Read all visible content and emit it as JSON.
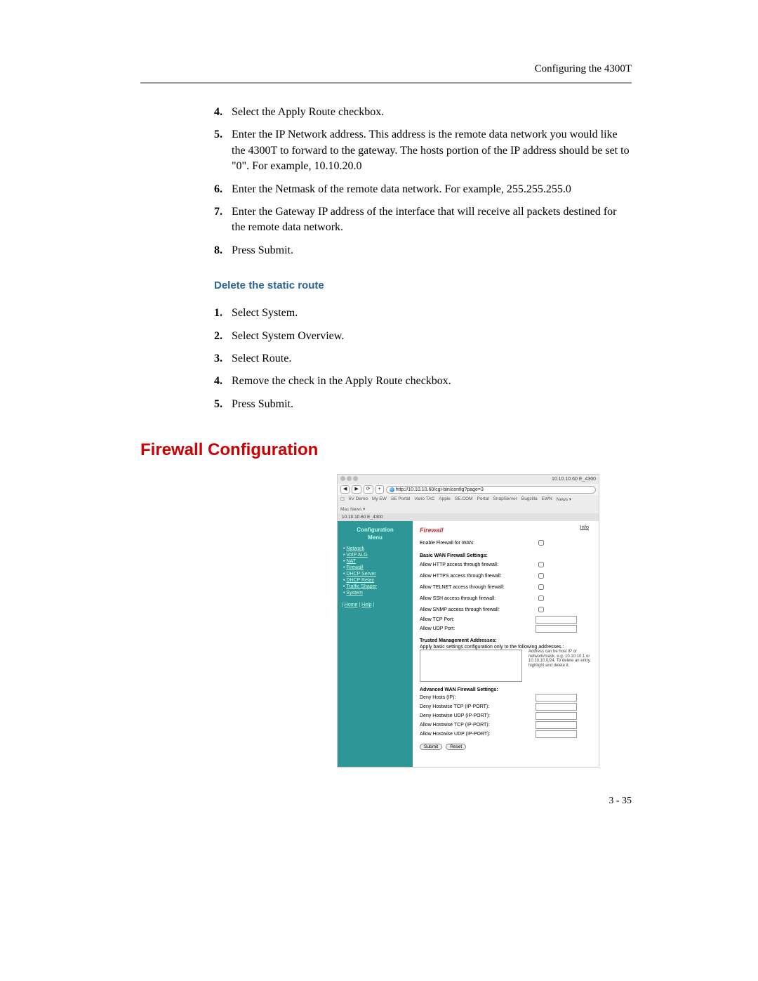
{
  "header": {
    "title": "Configuring the 4300T"
  },
  "steps1": [
    {
      "n": "4.",
      "t": "Select the Apply Route checkbox."
    },
    {
      "n": "5.",
      "t": "Enter the IP Network address.  This address is the remote data network you would like the 4300T to forward to the gateway.  The hosts portion of the IP address should be set to \"0\".  For example, 10.10.20.0"
    },
    {
      "n": "6.",
      "t": "Enter the Netmask of the remote data network.  For example, 255.255.255.0"
    },
    {
      "n": "7.",
      "t": "Enter the Gateway IP address of the interface that will receive all packets destined for the remote data network."
    },
    {
      "n": "8.",
      "t": "Press Submit."
    }
  ],
  "subhead": "Delete the static route",
  "steps2": [
    {
      "n": "1.",
      "t": "Select System."
    },
    {
      "n": "2.",
      "t": "Select System Overview."
    },
    {
      "n": "3.",
      "t": "Select Route."
    },
    {
      "n": "4.",
      "t": "Remove the check in the Apply Route checkbox."
    },
    {
      "n": "5.",
      "t": "Press Submit."
    }
  ],
  "section": "Firewall Configuration",
  "page_num": "3 - 35",
  "shot": {
    "tb_right": "10.10.10.60 E_4300",
    "url": "http://10.10.10.60/cgi-bin/config?page=3",
    "bookmarks": [
      "6V Demo",
      "My EW",
      "SE Portal",
      "Vario TAC",
      "Apple",
      "SE.COM",
      "Portal",
      "SnapServer",
      "Bugzilla",
      "EWN",
      "News ▾",
      "Mac News ▾"
    ],
    "tab": "10.10.10.60 E_4300",
    "sidebar": {
      "title1": "Configuration",
      "title2": "Menu",
      "items": [
        "Network",
        "VoIP ALG",
        "NAT",
        "Firewall",
        "DHCP Server",
        "DHCP Relay",
        "Traffic Shaper",
        "System"
      ],
      "home": "Home",
      "help": "Help"
    },
    "main": {
      "info": "Info",
      "heading": "Firewall",
      "enable_label": "Enable Firewall for WAN:",
      "basic_title": "Basic WAN Firewall Settings:",
      "basic": [
        "Allow HTTP access through firewall:",
        "Allow HTTPS access through firewall:",
        "Allow TELNET access through firewall:",
        "Allow SSH access through firewall:",
        "Allow SNMP access through firewall:"
      ],
      "tcp_label": "Allow TCP Port:",
      "udp_label": "Allow UDP Port:",
      "trusted_title": "Trusted Management Addresses:",
      "trusted_text": "Apply basic settings configuration only to the following addresses.:",
      "hint": "Address can be host IP or network/mask, e.g. 10.10.10.1 or 10.10.10.0/24. To delete an entry, highlight and delete it.",
      "adv_title": "Advanced WAN Firewall Settings:",
      "adv": [
        "Deny Hosts (IP):",
        "Deny Hostwise TCP (IP-PORT):",
        "Deny Hostwise UDP (IP-PORT):",
        "Allow Hostwise TCP (IP-PORT):",
        "Allow Hostwise UDP (IP-PORT):"
      ],
      "submit": "Submit",
      "reset": "Reset"
    }
  }
}
